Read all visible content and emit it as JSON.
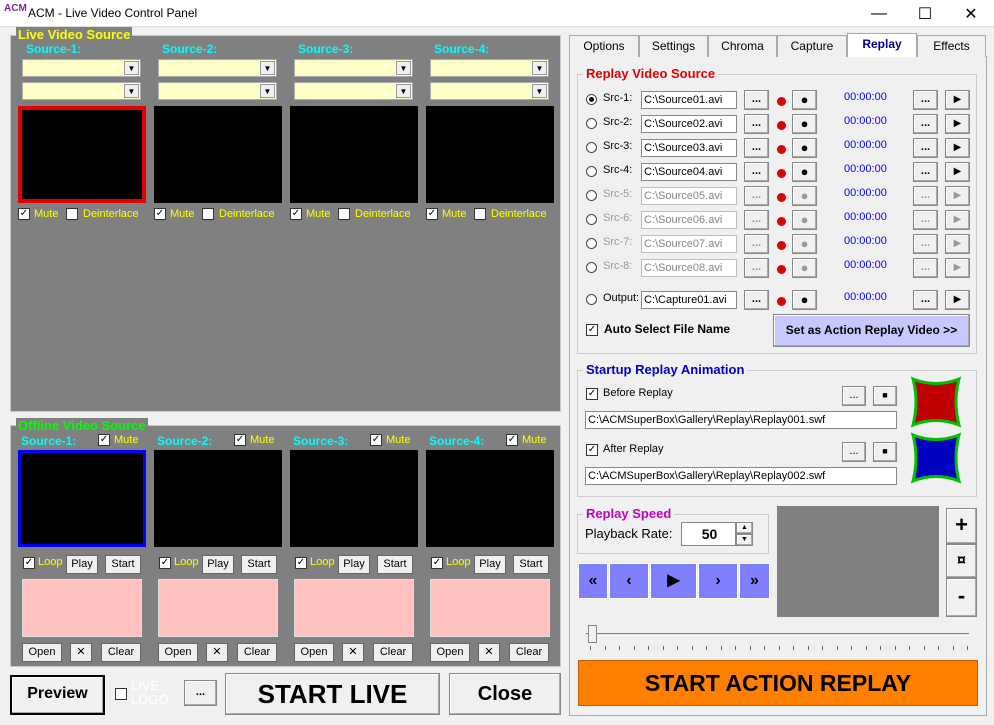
{
  "window": {
    "title": "ACM - Live Video Control Panel",
    "logo": "ACM",
    "min": "—",
    "max": "☐",
    "close": "✕"
  },
  "live": {
    "title": "Live Video Source",
    "mute": "Mute",
    "deinterlace": "Deinterlace",
    "sources": [
      {
        "label": "Source-1:"
      },
      {
        "label": "Source-2:"
      },
      {
        "label": "Source-3:"
      },
      {
        "label": "Source-4:"
      }
    ]
  },
  "offline": {
    "title": "Offline Video Source",
    "mute": "Mute",
    "loop": "Loop",
    "play": "Play",
    "start": "Start",
    "open": "Open",
    "x": "✕",
    "clear": "Clear",
    "sources": [
      {
        "label": "Source-1:"
      },
      {
        "label": "Source-2:"
      },
      {
        "label": "Source-3:"
      },
      {
        "label": "Source-4:"
      }
    ]
  },
  "bottom": {
    "preview": "Preview",
    "live_logo": "LIVE LOGO",
    "dots": "...",
    "start_live": "START LIVE",
    "close": "Close"
  },
  "tabs": [
    "Options",
    "Settings",
    "Chroma",
    "Capture",
    "Replay",
    "Effects"
  ],
  "replay_source": {
    "title": "Replay Video Source",
    "dots": "...",
    "play": "▶",
    "rec": "●",
    "rows": [
      {
        "label": "Src-1:",
        "file": "C:\\Source01.avi",
        "time": "00:00:00",
        "selected": true,
        "enabled": true
      },
      {
        "label": "Src-2:",
        "file": "C:\\Source02.avi",
        "time": "00:00:00",
        "selected": false,
        "enabled": true
      },
      {
        "label": "Src-3:",
        "file": "C:\\Source03.avi",
        "time": "00:00:00",
        "selected": false,
        "enabled": true
      },
      {
        "label": "Src-4:",
        "file": "C:\\Source04.avi",
        "time": "00:00:00",
        "selected": false,
        "enabled": true
      },
      {
        "label": "Src-5:",
        "file": "C:\\Source05.avi",
        "time": "00:00:00",
        "selected": false,
        "enabled": false
      },
      {
        "label": "Src-6:",
        "file": "C:\\Source06.avi",
        "time": "00:00:00",
        "selected": false,
        "enabled": false
      },
      {
        "label": "Src-7:",
        "file": "C:\\Source07.avi",
        "time": "00:00:00",
        "selected": false,
        "enabled": false
      },
      {
        "label": "Src-8:",
        "file": "C:\\Source08.avi",
        "time": "00:00:00",
        "selected": false,
        "enabled": false
      },
      {
        "label": "Output:",
        "file": "C:\\Capture01.avi",
        "time": "00:00:00",
        "selected": false,
        "enabled": true
      }
    ],
    "auto_select": "Auto Select File Name",
    "set_action": "Set as Action Replay Video >>"
  },
  "startup": {
    "title": "Startup Replay Animation",
    "before": "Before Replay",
    "before_file": "C:\\ACMSuperBox\\Gallery\\Replay\\Replay001.swf",
    "after": "After Replay",
    "after_file": "C:\\ACMSuperBox\\Gallery\\Replay\\Replay002.swf",
    "dots": "...",
    "stop": "■"
  },
  "speed": {
    "title": "Replay Speed",
    "label": "Playback Rate:",
    "value": "50"
  },
  "nav": [
    "«",
    "‹",
    "▶",
    "›",
    "»"
  ],
  "zoom": {
    "plus": "+",
    "reset": "¤",
    "minus": "-"
  },
  "start_replay": "START ACTION REPLAY",
  "colors": {
    "title_red": "#e00000",
    "title_blue": "#0000cc",
    "title_purple": "#c000c0",
    "orange": "#ff8000"
  }
}
